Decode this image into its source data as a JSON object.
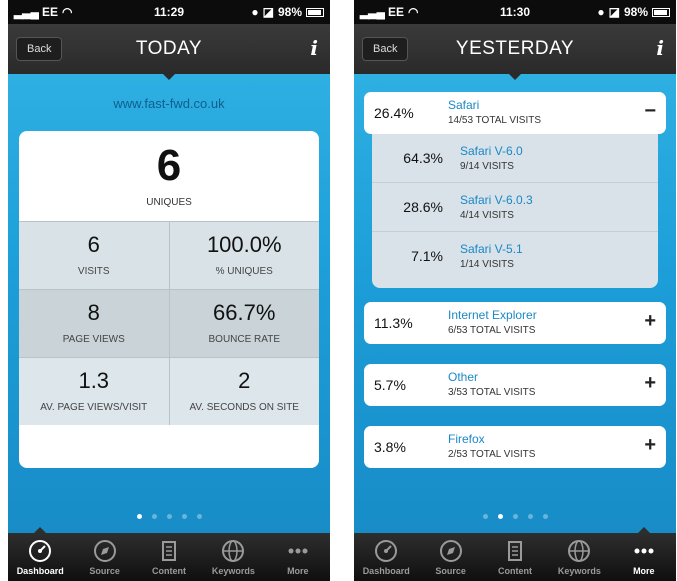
{
  "left": {
    "status": {
      "carrier": "EE",
      "time": "11:29",
      "battery": "98%"
    },
    "nav": {
      "back": "Back",
      "title": "TODAY",
      "info": "i"
    },
    "site_url": "www.fast-fwd.co.uk",
    "uniques": {
      "value": "6",
      "label": "UNIQUES"
    },
    "stats": [
      {
        "value": "6",
        "label": "VISITS"
      },
      {
        "value": "100.0%",
        "label": "% UNIQUES"
      },
      {
        "value": "8",
        "label": "PAGE VIEWS"
      },
      {
        "value": "66.7%",
        "label": "BOUNCE RATE"
      },
      {
        "value": "1.3",
        "label": "AV. PAGE VIEWS/VISIT"
      },
      {
        "value": "2",
        "label": "AV. SECONDS ON SITE"
      }
    ],
    "active_page": 1
  },
  "right": {
    "status": {
      "carrier": "EE",
      "time": "11:30",
      "battery": "98%"
    },
    "nav": {
      "back": "Back",
      "title": "YESTERDAY",
      "info": "i"
    },
    "browsers": [
      {
        "pct": "26.4%",
        "name": "Safari",
        "visits": "14/53 TOTAL VISITS",
        "toggle": "−"
      },
      {
        "pct": "11.3%",
        "name": "Internet Explorer",
        "visits": "6/53 TOTAL VISITS",
        "toggle": "+"
      },
      {
        "pct": "5.7%",
        "name": "Other",
        "visits": "3/53 TOTAL VISITS",
        "toggle": "+"
      },
      {
        "pct": "3.8%",
        "name": "Firefox",
        "visits": "2/53 TOTAL VISITS",
        "toggle": "+"
      }
    ],
    "safari_versions": [
      {
        "pct": "64.3%",
        "name": "Safari V-6.0",
        "visits": "9/14 VISITS"
      },
      {
        "pct": "28.6%",
        "name": "Safari V-6.0.3",
        "visits": "4/14 VISITS"
      },
      {
        "pct": "7.1%",
        "name": "Safari V-5.1",
        "visits": "1/14 VISITS"
      }
    ],
    "active_page": 2
  },
  "tabs": [
    "Dashboard",
    "Source",
    "Content",
    "Keywords",
    "More"
  ],
  "icons": [
    "dashboard-icon",
    "source-icon",
    "content-icon",
    "keywords-icon",
    "more-icon"
  ]
}
